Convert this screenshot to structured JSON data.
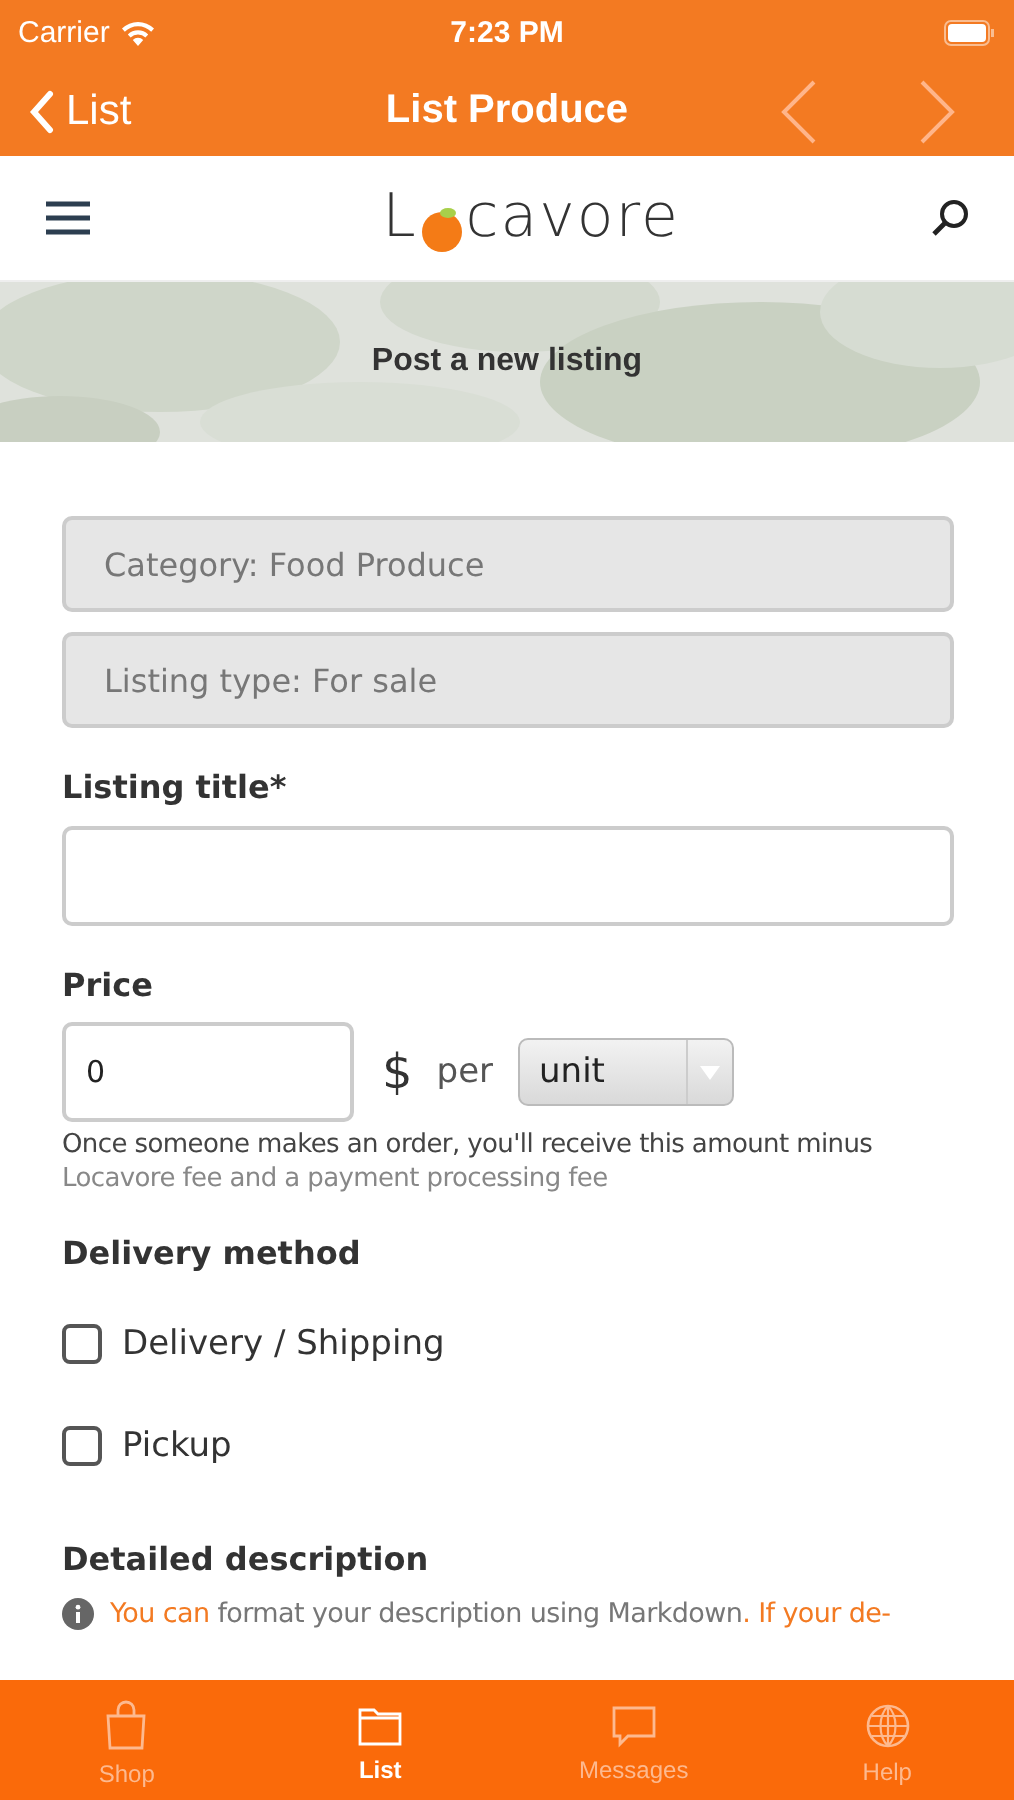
{
  "status_bar": {
    "carrier": "Carrier",
    "time": "7:23 PM"
  },
  "nav_bar": {
    "back": "List",
    "title": "List Produce"
  },
  "header": {
    "logo_start": "L",
    "logo_end": "cavore"
  },
  "hero": {
    "kind": "picture",
    "title": "Post a new listing"
  },
  "form": {
    "readonly_fields": [
      {
        "value": "Category: Food Produce"
      },
      {
        "value": "Listing type: For sale"
      }
    ],
    "title_label": "Listing title*",
    "price_label": "Price",
    "price_value": "0",
    "currency": "$",
    "per": "per",
    "unit": "unit",
    "price_note": "Once someone makes an order, you'll receive this amount minus",
    "price_note_2": "Locavore fee and a payment processing fee",
    "delivery_label": "Delivery method",
    "delivery_options": [
      {
        "label": "Delivery / Shipping",
        "checked": false
      },
      {
        "label": "Pickup",
        "checked": false
      }
    ],
    "description_label": "Detailed description",
    "description_hint": {
      "link_start": "You can",
      "text": " format your description using Markdown",
      "link_end": ". If your de-"
    }
  },
  "tab_bar": [
    {
      "label": "Shop",
      "selected": false
    },
    {
      "label": "List",
      "selected": true
    },
    {
      "label": "Messages",
      "selected": false
    },
    {
      "label": "Help",
      "selected": false
    }
  ]
}
